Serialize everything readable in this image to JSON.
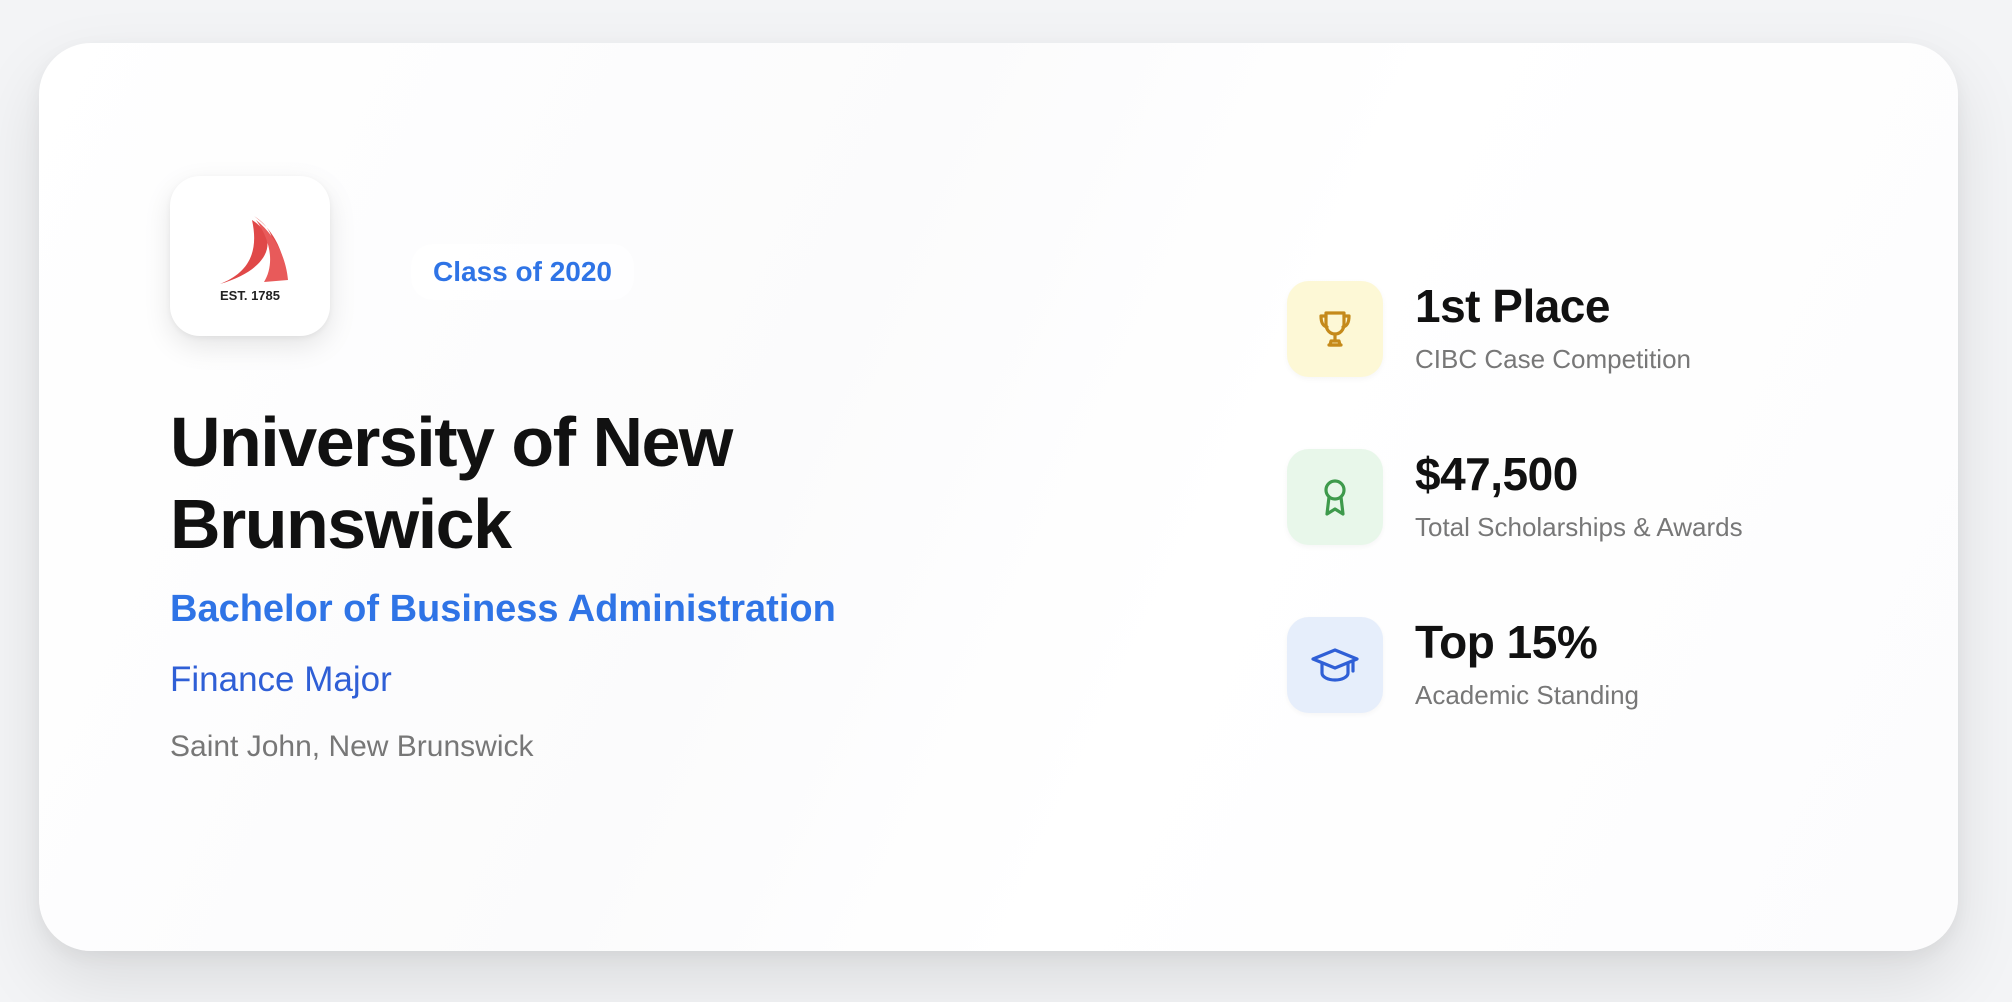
{
  "logo": {
    "text": "EST. 1785",
    "icon": "sail-logo-icon",
    "color": "#e04848"
  },
  "badge": {
    "label": "Class of 2020"
  },
  "institution": {
    "name": "University of New Brunswick",
    "degree": "Bachelor of Business Administration",
    "major": "Finance Major",
    "location": "Saint John, New Brunswick"
  },
  "stats": [
    {
      "value": "1st Place",
      "label": "CIBC Case Competition",
      "icon": "trophy-icon",
      "icon_color": "#c58a1b",
      "bg_color": "#fdf8d6"
    },
    {
      "value": "$47,500",
      "label": "Total Scholarships & Awards",
      "icon": "award-ribbon-icon",
      "icon_color": "#3e9a4c",
      "bg_color": "#e8f7ea"
    },
    {
      "value": "Top 15%",
      "label": "Academic Standing",
      "icon": "graduation-cap-icon",
      "icon_color": "#2f5fd6",
      "bg_color": "#e6eefb"
    }
  ],
  "colors": {
    "accent": "#2f74e6",
    "text_primary": "#111111",
    "text_secondary": "#777777"
  }
}
